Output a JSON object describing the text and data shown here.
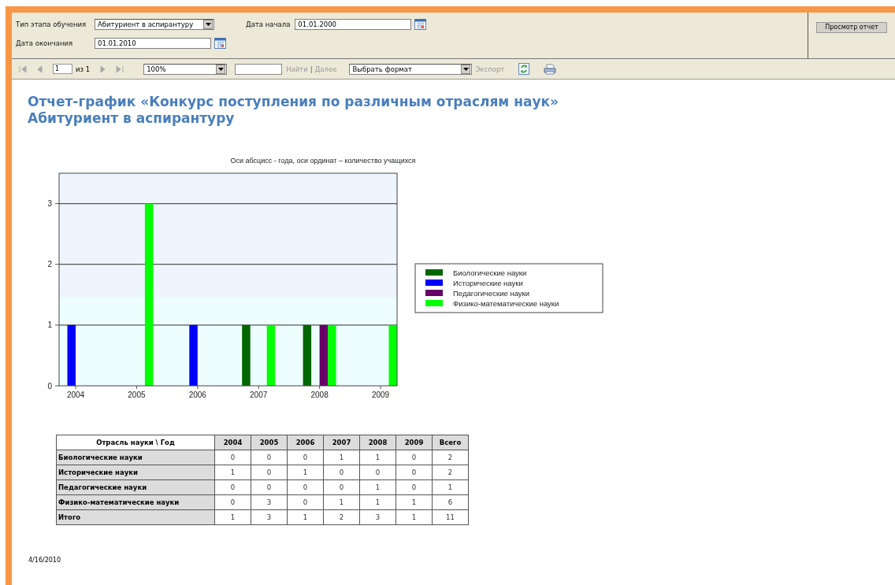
{
  "parameters": {
    "rows": [
      [
        {
          "kind": "select",
          "label": "Тип этапа обучения",
          "value": "Абитуриент в аспирантуру"
        },
        {
          "kind": "date",
          "label": "Дата начала",
          "value": "01.01.2000"
        }
      ],
      [
        {
          "kind": "date",
          "label": "Дата окончания",
          "value": "01.01.2010"
        }
      ]
    ],
    "view_button": "Просмотр отчет"
  },
  "toolbar": {
    "nav_buttons": [
      {
        "kind": "first",
        "disabled": true
      },
      {
        "kind": "prev",
        "disabled": true
      }
    ],
    "page": "1",
    "page_of": "из 1",
    "nav_buttons_after": [
      {
        "kind": "next",
        "disabled": true
      },
      {
        "kind": "last",
        "disabled": true
      }
    ],
    "zoom": "100%",
    "find_links": [
      {
        "label": "Найти",
        "disabled": true
      },
      {
        "label": "Далее",
        "disabled": true
      }
    ],
    "find_separator": "|",
    "format": "Выбрать формат",
    "export": {
      "label": "Экспорт",
      "disabled": true
    }
  },
  "report": {
    "title": [
      "Отчет-график «Конкурс поступления по различным отраслям наук»",
      "Абитуриент в аспирантуру"
    ],
    "chart_data": {
      "type": "bar",
      "title": "Оси абсцисс - года, оси ординат – количество учащихся",
      "categories": [
        "2004",
        "2005",
        "2006",
        "2007",
        "2008",
        "2009"
      ],
      "series": [
        {
          "name": "Биологические науки",
          "color": "#006600",
          "values": [
            0,
            0,
            0,
            1,
            1,
            0
          ]
        },
        {
          "name": "Исторические науки",
          "color": "#0000ff",
          "values": [
            1,
            0,
            1,
            0,
            0,
            0
          ]
        },
        {
          "name": "Педагогические науки",
          "color": "#660066",
          "values": [
            0,
            0,
            0,
            0,
            1,
            0
          ]
        },
        {
          "name": "Физико-математические науки",
          "color": "#00ff00",
          "values": [
            0,
            3,
            0,
            1,
            1,
            1
          ]
        }
      ],
      "ylim": [
        0,
        3.5
      ],
      "yticks": [
        0,
        1,
        2,
        3
      ],
      "grid": true,
      "legend": "right"
    },
    "table": {
      "columns": [
        "Отрасль науки \\ Год",
        "2004",
        "2005",
        "2006",
        "2007",
        "2008",
        "2009",
        "Всего"
      ],
      "rows": [
        [
          "Биологические науки",
          "0",
          "0",
          "0",
          "1",
          "1",
          "0",
          "2"
        ],
        [
          "Исторические науки",
          "1",
          "0",
          "1",
          "0",
          "0",
          "0",
          "2"
        ],
        [
          "Педагогические науки",
          "0",
          "0",
          "0",
          "0",
          "1",
          "0",
          "1"
        ],
        [
          "Физико-математические науки",
          "0",
          "3",
          "0",
          "1",
          "1",
          "1",
          "6"
        ],
        [
          "Итого",
          "1",
          "3",
          "1",
          "2",
          "3",
          "1",
          "11"
        ]
      ]
    },
    "date": "4/16/2010"
  }
}
